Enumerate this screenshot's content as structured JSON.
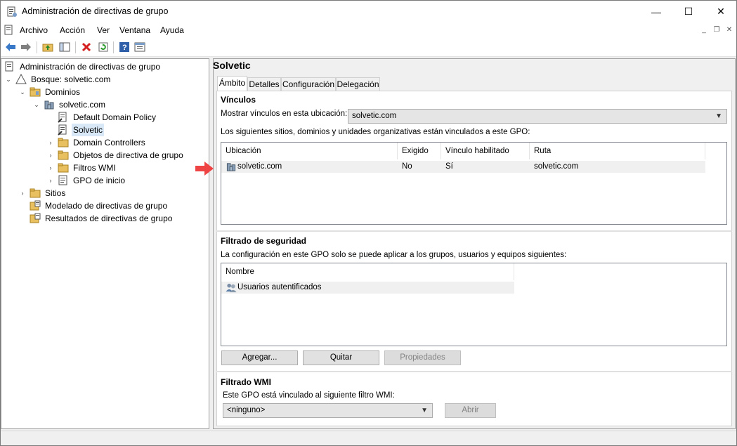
{
  "window": {
    "title": "Administración de directivas de grupo",
    "minimize": "—",
    "maximize": "☐",
    "close": "✕"
  },
  "menu": {
    "items": [
      "Archivo",
      "Acción",
      "Ver",
      "Ventana",
      "Ayuda"
    ],
    "mdi_min": "_",
    "mdi_restore": "❐",
    "mdi_close": "✕"
  },
  "toolbar": {
    "icons": [
      "back-arrow-icon",
      "forward-arrow-icon",
      "folder-up-icon",
      "show-hide-tree-icon",
      "delete-icon",
      "refresh-icon",
      "help-icon",
      "properties-icon"
    ]
  },
  "tree": {
    "root": "Administración de directivas de grupo",
    "forest": "Bosque: solvetic.com",
    "domains": "Dominios",
    "domain": "solvetic.com",
    "items": [
      "Default Domain Policy",
      "Solvetic",
      "Domain Controllers",
      "Objetos de directiva de grupo",
      "Filtros WMI",
      "GPO de inicio"
    ],
    "sites": "Sitios",
    "modeling": "Modelado de directivas de grupo",
    "results": "Resultados de directivas de grupo",
    "expanded_glyph": "⌄",
    "collapsed_glyph": "›"
  },
  "right": {
    "title": "Solvetic",
    "tabs": [
      "Ámbito",
      "Detalles",
      "Configuración",
      "Delegación"
    ],
    "links": {
      "heading": "Vínculos",
      "show_label": "Mostrar vínculos en esta ubicación:",
      "location": "solvetic.com",
      "description": "Los siguientes sitios, dominios y unidades organizativas están vinculados a este GPO:",
      "columns": [
        "Ubicación",
        "Exigido",
        "Vínculo habilitado",
        "Ruta"
      ],
      "rows": [
        [
          "solvetic.com",
          "No",
          "Sí",
          "solvetic.com"
        ]
      ]
    },
    "security": {
      "heading": "Filtrado de seguridad",
      "description": "La configuración en este GPO solo se puede aplicar a los grupos, usuarios y equipos siguientes:",
      "column": "Nombre",
      "rows": [
        "Usuarios autentificados"
      ],
      "add": "Agregar...",
      "remove": "Quitar",
      "properties": "Propiedades"
    },
    "wmi": {
      "heading": "Filtrado WMI",
      "description": "Este GPO está vinculado al siguiente filtro WMI:",
      "value": "<ninguno>",
      "open": "Abrir"
    }
  },
  "colors": {
    "selection": "#d9e8f7",
    "annotation_arrow": "#ef4444"
  }
}
